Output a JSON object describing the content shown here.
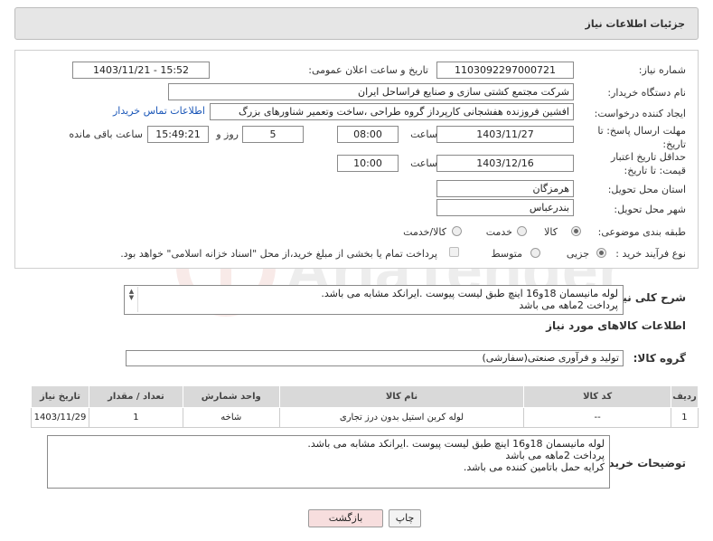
{
  "header": {
    "title": "جزئیات اطلاعات نیاز"
  },
  "form": {
    "need_number": {
      "label": "شماره نیاز:",
      "value": "1103092297000721"
    },
    "announce_datetime": {
      "label": "تاریخ و ساعت اعلان عمومی:",
      "value": "1403/11/21 - 15:52"
    },
    "buyer_org": {
      "label": "نام دستگاه خریدار:",
      "value": "شرکت مجتمع کشتی سازی و صنایع فراساحل ایران"
    },
    "requester": {
      "label": "ایجاد کننده درخواست:",
      "value": "افشین فروزنده هفشجانی کارپرداز گروه طراحی ،ساخت وتعمیر شناورهای بزرگ",
      "contact_link": "اطلاعات تماس خریدار"
    },
    "reply_deadline": {
      "label": "مهلت ارسال پاسخ: تا تاریخ:",
      "date": "1403/11/27",
      "time_label": "ساعت",
      "time": "08:00",
      "days": "5",
      "days_label": "روز و",
      "remaining": "15:49:21",
      "remaining_label": "ساعت باقی مانده"
    },
    "price_validity": {
      "label": "حداقل تاریخ اعتبار قیمت: تا تاریخ:",
      "date": "1403/12/16",
      "time_label": "ساعت",
      "time": "10:00"
    },
    "province": {
      "label": "استان محل تحویل:",
      "value": "هرمزگان"
    },
    "city": {
      "label": "شهر محل تحویل:",
      "value": "بندرعباس"
    },
    "category": {
      "label": "طبقه بندی موضوعی:",
      "options": [
        "کالا",
        "خدمت",
        "کالا/خدمت"
      ],
      "selected": "کالا"
    },
    "purchase_type": {
      "label": "نوع فرآیند خرید :",
      "options": [
        "جزیی",
        "متوسط"
      ],
      "selected": "جزیی",
      "payment_note": "پرداخت تمام یا بخشی از مبلغ خرید،از محل \"اسناد خزانه اسلامی\" خواهد بود."
    }
  },
  "description": {
    "label": "شرح کلی نیاز:",
    "lines": [
      "لوله مانیسمان 18و16 اینچ طبق لیست پیوست .ایرانکد مشابه می باشد.",
      "پرداخت 2ماهه می باشد"
    ]
  },
  "goods": {
    "section_title": "اطلاعات کالاهای مورد نیاز",
    "group_label": "گروه کالا:",
    "group_value": "تولید و فرآوری صنعتی(سفارشی)",
    "table": {
      "headers": [
        "ردیف",
        "کد کالا",
        "نام کالا",
        "واحد شمارش",
        "تعداد / مقدار",
        "تاریخ نیاز"
      ],
      "rows": [
        [
          "1",
          "--",
          "لوله کربن استیل بدون درز تجاری",
          "شاخه",
          "1",
          "1403/11/29"
        ]
      ]
    }
  },
  "buyer_notes": {
    "label": "توضیحات خریدار:",
    "lines": [
      "لوله مانیسمان 18و16 اینچ طبق لیست پیوست .ایرانکد مشابه می باشد.",
      "پرداخت 2ماهه می باشد",
      "کرایه حمل باتامین کننده می باشد."
    ]
  },
  "buttons": {
    "print": "چاپ",
    "back": "بازگشت"
  },
  "colors": {
    "header_bg": "#e6e6e6",
    "link": "#1b57b8",
    "back_button_bg": "#f7dede",
    "print_button_bg": "#f3f3f3",
    "table_header_bg": "#d9d9d9"
  }
}
